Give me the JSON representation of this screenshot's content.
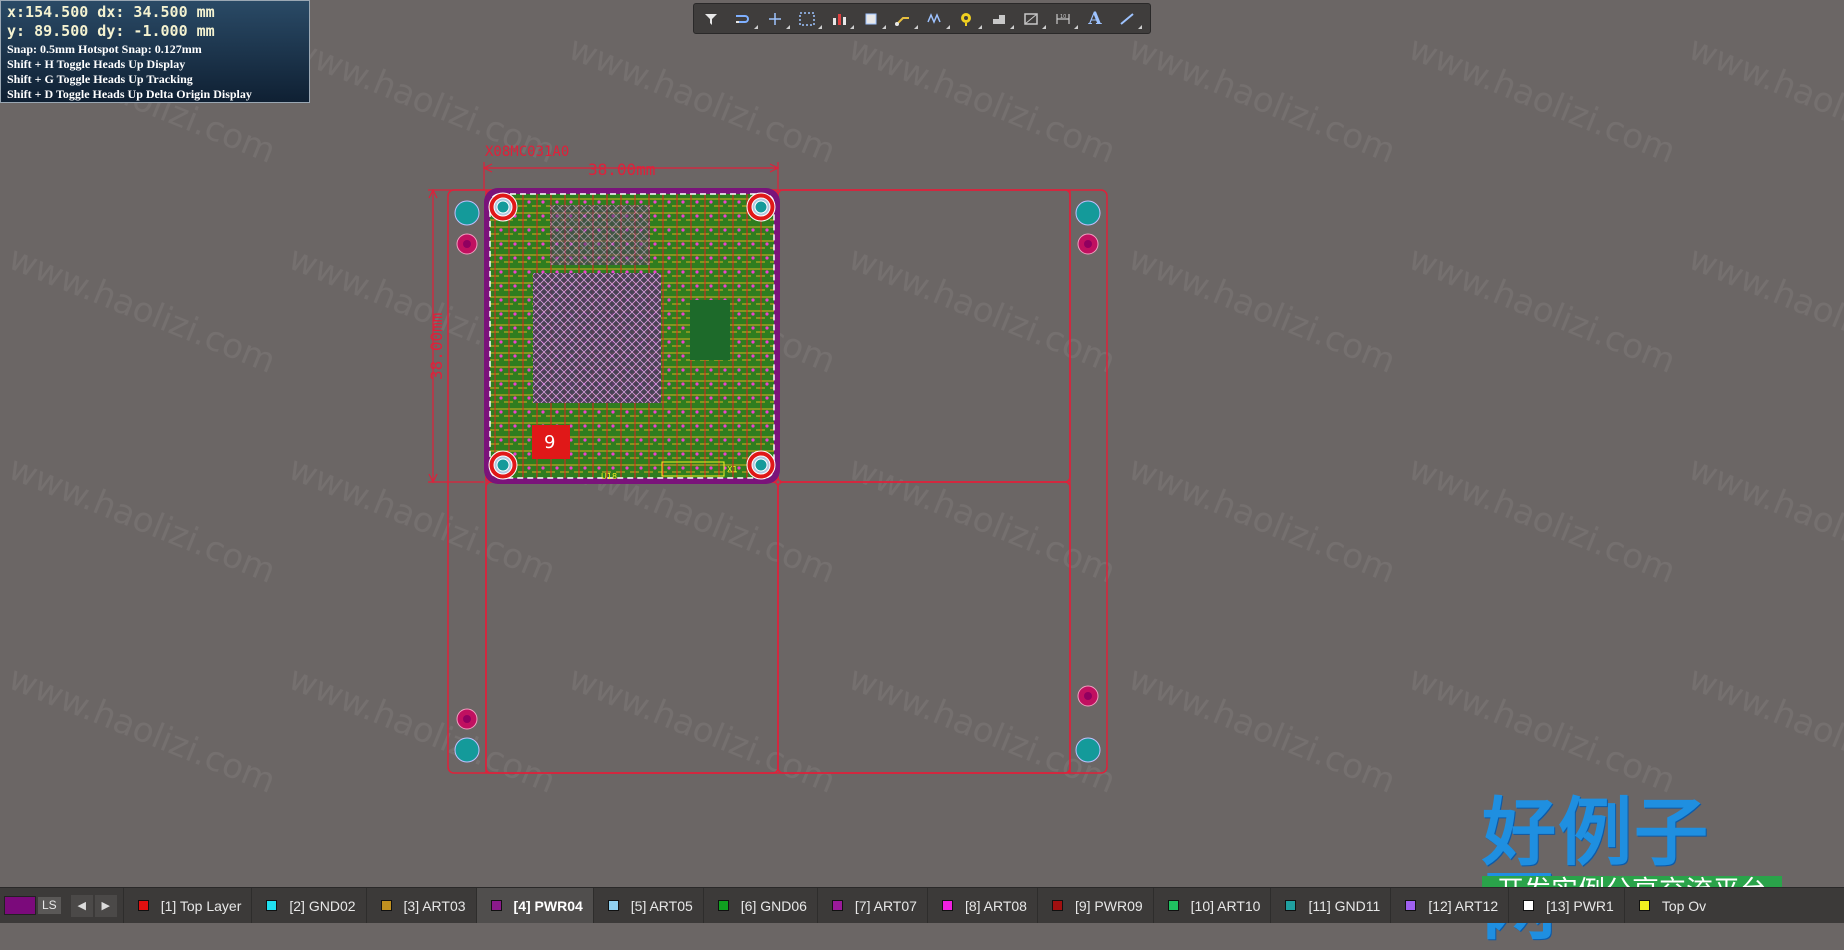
{
  "hud": {
    "line1": "x:154.500   dx: 34.500 mm",
    "line2": "y: 89.500   dy: -1.000  mm",
    "line3": "Snap: 0.5mm Hotspot Snap: 0.127mm",
    "line4": "Shift + H  Toggle Heads Up Display",
    "line5": "Shift + G  Toggle Heads Up Tracking",
    "line6": "Shift + D  Toggle Heads Up Delta Origin Display"
  },
  "toolbar": {
    "buttons": [
      "filter-icon",
      "route-icon",
      "plus-icon",
      "select-rect-icon",
      "bar-chart-icon",
      "component-icon",
      "interactive-route-icon",
      "tune-length-icon",
      "via-icon",
      "polygon-icon",
      "region-icon",
      "dimension-icon",
      "text-icon",
      "line-icon"
    ]
  },
  "board": {
    "designator": "X08MC031A0",
    "width_dim": "38.00mm",
    "height_dim": "38.00mm",
    "chip_label": "9",
    "label_u": "U18",
    "label_x": "X1"
  },
  "watermark": "www.haolizi.com",
  "layers": {
    "ls_label": "LS",
    "items": [
      {
        "label": "[1] Top Layer",
        "color": "#e01010",
        "active": false
      },
      {
        "label": "[2] GND02",
        "color": "#20e0f0",
        "active": false
      },
      {
        "label": "[3] ART03",
        "color": "#c09020",
        "active": false
      },
      {
        "label": "[4] PWR04",
        "color": "#8a1a8a",
        "active": true
      },
      {
        "label": "[5] ART05",
        "color": "#90d0f0",
        "active": false
      },
      {
        "label": "[6] GND06",
        "color": "#10a020",
        "active": false
      },
      {
        "label": "[7] ART07",
        "color": "#9a1a9a",
        "active": false
      },
      {
        "label": "[8] ART08",
        "color": "#f020e0",
        "active": false
      },
      {
        "label": "[9] PWR09",
        "color": "#a01010",
        "active": false
      },
      {
        "label": "[10] ART10",
        "color": "#20c060",
        "active": false
      },
      {
        "label": "[11] GND11",
        "color": "#20a0a0",
        "active": false
      },
      {
        "label": "[12] ART12",
        "color": "#a060f0",
        "active": false
      },
      {
        "label": "[13] PWR1",
        "color": "#ffffff",
        "active": false
      },
      {
        "label": "Top Ov",
        "color": "#f0f020",
        "active": false
      }
    ]
  },
  "logo": {
    "title": "好例子网",
    "subtitle": "开发实例分享交流平台"
  }
}
